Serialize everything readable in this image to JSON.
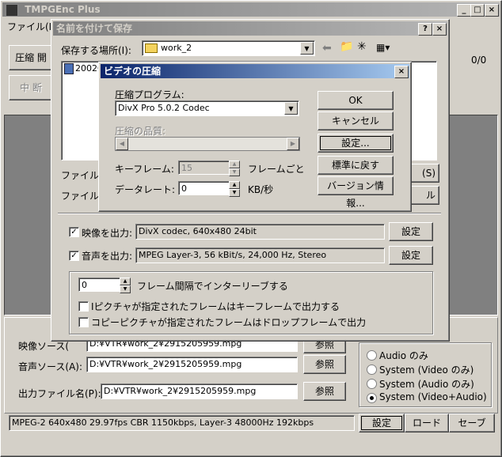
{
  "main": {
    "title": "TMPGEnc Plus",
    "menu_file": "ファイル(F)",
    "encode_button": "圧縮 開",
    "stop_button": "中 断",
    "counter": "0/0",
    "video_source_label": "映像ソース(",
    "video_source_value": "D:¥VTR¥work_2¥2915205959.mpg",
    "video_source_browse": "参照",
    "audio_source_label": "音声ソース(A):",
    "audio_source_value": "D:¥VTR¥work_2¥2915205959.mpg",
    "audio_source_browse": "参照",
    "output_label": "出力ファイル名(P):",
    "output_value": "D:¥VTR¥work_2¥2915205959.mpg",
    "output_browse": "参照",
    "radio_options": [
      "Audio のみ",
      "System (Video のみ)",
      "System (Audio のみ)",
      "System (Video+Audio)"
    ],
    "selected_radio": 3,
    "status_text": "MPEG-2 640x480 29.97fps CBR 1150kbps,  Layer-3 48000Hz 192kbps",
    "settings_button": "設定",
    "load_button": "ロード",
    "save_button": "セーブ"
  },
  "save_dialog": {
    "title": "名前を付けて保存",
    "location_label": "保存する場所(I):",
    "location_value": "work_2",
    "file_item": "2002C",
    "filename_label": "ファイル名(",
    "filetype_label": "ファイルの種",
    "save_btn_partial": "(S)",
    "cancel_btn_partial": "ル",
    "video_out_label": "映像を出力:",
    "video_out_value": "DivX codec, 640x480 24bit",
    "video_out_settings": "設定",
    "audio_out_label": "音声を出力:",
    "audio_out_value": "MPEG Layer-3, 56 kBit/s, 24,000 Hz, Stereo",
    "audio_out_settings": "設定",
    "interleave_value": "0",
    "interleave_label": "フレーム間隔でインターリーブする",
    "option_i_picture": "Iピクチャが指定されたフレームはキーフレームで出力する",
    "option_copy_picture": "コピーピクチャが指定されたフレームはドロップフレームで出力"
  },
  "compress_dialog": {
    "title": "ビデオの圧縮",
    "program_label": "圧縮プログラム:",
    "program_value": "DivX Pro 5.0.2 Codec",
    "quality_label": "圧縮の品質:",
    "keyframe_label": "キーフレーム:",
    "keyframe_value": "15",
    "keyframe_unit": "フレームごと",
    "datarate_label": "データレート:",
    "datarate_value": "0",
    "datarate_unit": "KB/秒",
    "ok_button": "OK",
    "cancel_button": "キャンセル",
    "configure_button": "設定...",
    "defaults_button": "標準に戻す",
    "version_button": "バージョン情報..."
  }
}
